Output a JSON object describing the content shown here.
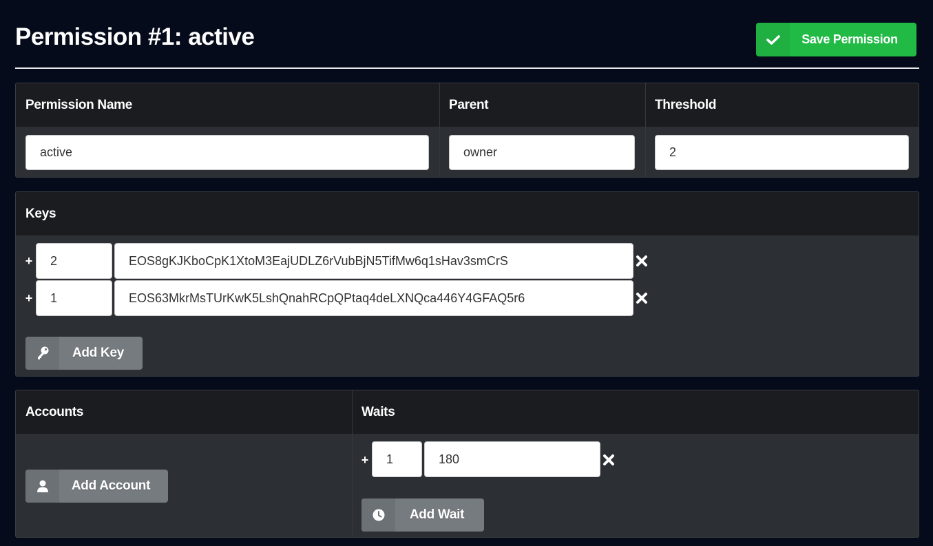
{
  "header": {
    "title": "Permission #1: active",
    "save_label": "Save Permission"
  },
  "permission": {
    "name_header": "Permission Name",
    "parent_header": "Parent",
    "threshold_header": "Threshold",
    "name_value": "active",
    "parent_value": "owner",
    "threshold_value": "2"
  },
  "keys": {
    "header": "Keys",
    "plus": "+",
    "items": [
      {
        "weight": "2",
        "key": "EOS8gKJKboCpK1XtoM3EajUDLZ6rVubBjN5TifMw6q1sHav3smCrS"
      },
      {
        "weight": "1",
        "key": "EOS63MkrMsTUrKwK5LshQnahRCpQPtaq4deLXNQca446Y4GFAQ5r6"
      }
    ],
    "add_label": "Add Key"
  },
  "accounts": {
    "header": "Accounts",
    "add_label": "Add Account"
  },
  "waits": {
    "header": "Waits",
    "plus": "+",
    "items": [
      {
        "weight": "1",
        "seconds": "180"
      }
    ],
    "add_label": "Add Wait"
  },
  "colors": {
    "background": "#050b1a",
    "save_green": "#21ba45",
    "panel_head": "#1b1c1f",
    "panel_body": "#2c2f33",
    "button_grey": "#767b80"
  },
  "icons": {
    "save": "check-icon",
    "remove": "close-x-icon",
    "add_key": "key-icon",
    "add_account": "user-icon",
    "add_wait": "clock-icon"
  }
}
